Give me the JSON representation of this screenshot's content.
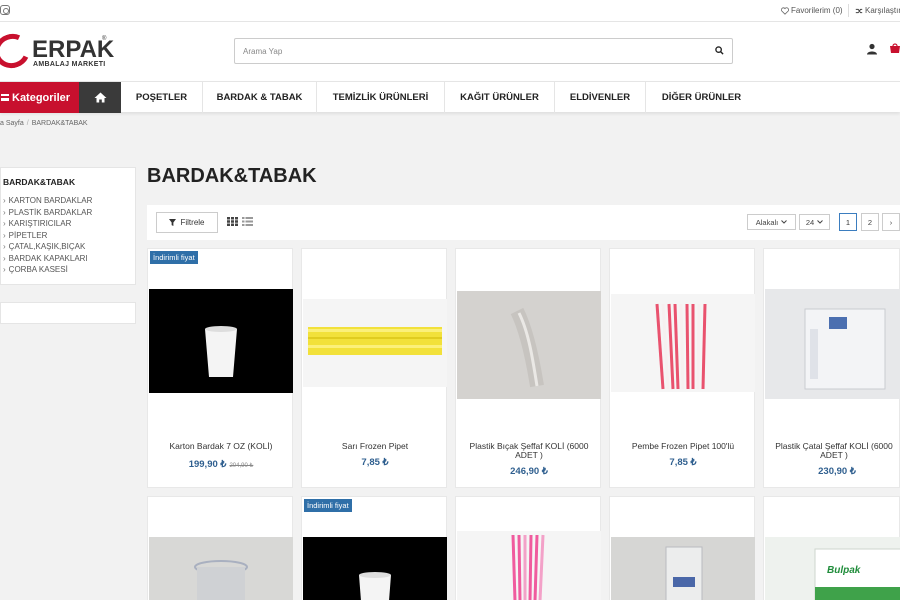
{
  "topbar": {
    "favorites_label": "Favorilerim (0)",
    "compare_label": "Karşılaştır"
  },
  "brand": {
    "name": "ERPAK",
    "registered": "®",
    "subtitle": "AMBALAJ MARKETI"
  },
  "search": {
    "placeholder": "Arama Yap"
  },
  "nav": {
    "categories_label": "Kategoriler",
    "items": [
      "POŞETLER",
      "BARDAK & TABAK",
      "TEMİZLİK ÜRÜNLERİ",
      "KAĞIT ÜRÜNLER",
      "ELDİVENLER",
      "DİĞER ÜRÜNLER"
    ]
  },
  "breadcrumb": {
    "home": "a Sayfa",
    "separator": "/",
    "current": "BARDAK&TABAK"
  },
  "sidebar": {
    "title": "BARDAK&TABAK",
    "items": [
      "KARTON BARDAKLAR",
      "PLASTİK BARDAKLAR",
      "KARIŞTIRICILAR",
      "PİPETLER",
      "ÇATAL,KAŞIK,BIÇAK",
      "BARDAK KAPAKLARI",
      "ÇORBA KASESİ"
    ]
  },
  "page_title": "BARDAK&TABAK",
  "toolbar": {
    "filter_label": "Filtrele",
    "sort_label": "Alakalı",
    "per_page": "24",
    "pages": [
      "1",
      "2"
    ],
    "next": "›"
  },
  "products": [
    {
      "name": "Karton Bardak 7 OZ (KOLİ)",
      "price": "199,90 ₺",
      "old_price": "204,90 ₺",
      "badge": "İndirimli fiyat",
      "image": "white-cup"
    },
    {
      "name": "Sarı Frozen Pipet",
      "price": "7,85 ₺",
      "old_price": "",
      "badge": "",
      "image": "yellow-straws"
    },
    {
      "name": "Plastik Bıçak Şeffaf KOLİ (6000 ADET )",
      "price": "246,90 ₺",
      "old_price": "",
      "badge": "",
      "image": "clear-knives"
    },
    {
      "name": "Pembe Frozen Pipet 100'lü",
      "price": "7,85 ₺",
      "old_price": "",
      "badge": "",
      "image": "pink-straws"
    },
    {
      "name": "Plastik Çatal Şeffaf KOLİ (6000 ADET )",
      "price": "230,90 ₺",
      "old_price": "",
      "badge": "",
      "image": "clear-forks"
    },
    {
      "name": "",
      "price": "",
      "old_price": "",
      "badge": "",
      "image": "clear-cups"
    },
    {
      "name": "",
      "price": "",
      "old_price": "",
      "badge": "İndirimli fiyat",
      "image": "white-cup"
    },
    {
      "name": "",
      "price": "",
      "old_price": "",
      "badge": "",
      "image": "pink-straws"
    },
    {
      "name": "",
      "price": "",
      "old_price": "",
      "badge": "",
      "image": "clear-package"
    },
    {
      "name": "",
      "price": "",
      "old_price": "",
      "badge": "",
      "image": "bulpak-box",
      "brand_text": "Bulpak"
    }
  ],
  "colors": {
    "accent": "#c8102e",
    "dark": "#3a3a3a",
    "price": "#2f5f8f",
    "badge": "#2f6fa8"
  }
}
